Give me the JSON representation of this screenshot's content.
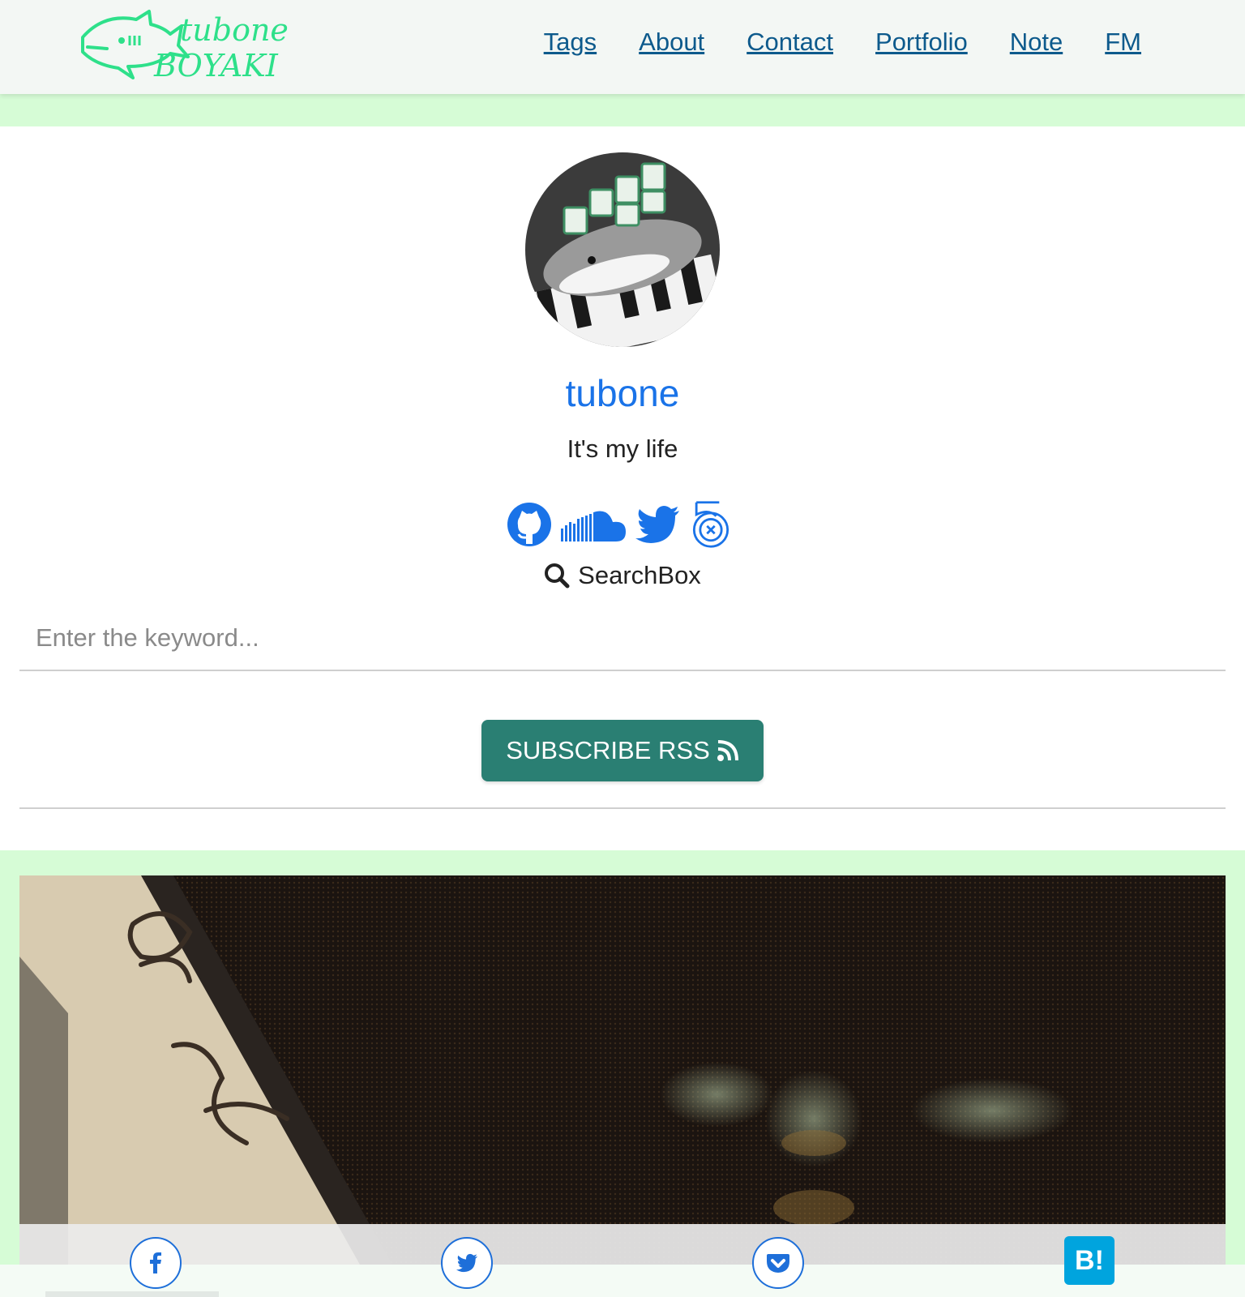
{
  "site": {
    "logo_text_top": "tubone",
    "logo_text_bottom": "BOYAKI",
    "brand_color": "#2ee08a"
  },
  "nav": {
    "items": [
      {
        "label": "Tags"
      },
      {
        "label": "About"
      },
      {
        "label": "Contact"
      },
      {
        "label": "Portfolio"
      },
      {
        "label": "Note"
      },
      {
        "label": "FM"
      }
    ]
  },
  "profile": {
    "name": "tubone",
    "tagline": "It's my life",
    "socials": [
      {
        "icon": "github-icon"
      },
      {
        "icon": "soundcloud-icon"
      },
      {
        "icon": "twitter-icon"
      },
      {
        "icon": "500px-icon"
      }
    ]
  },
  "search": {
    "label": "SearchBox",
    "placeholder": "Enter the keyword..."
  },
  "rss": {
    "label": "SUBSCRIBE RSS",
    "color": "#2a7f73"
  },
  "share": {
    "items": [
      {
        "icon": "facebook-icon"
      },
      {
        "icon": "twitter-icon"
      },
      {
        "icon": "pocket-icon"
      },
      {
        "icon": "hatena-bookmark-icon",
        "label": "B!"
      }
    ]
  }
}
